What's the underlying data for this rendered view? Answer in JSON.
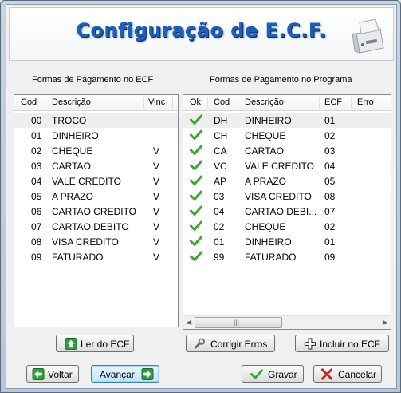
{
  "title": "Configuração de E.C.F.",
  "ecf": {
    "label": "Formas de Pagamento no ECF",
    "columns": [
      "Cod",
      "Descrição",
      "Vinc"
    ],
    "rows": [
      {
        "cod": "00",
        "desc": "TROCO",
        "vinc": ""
      },
      {
        "cod": "01",
        "desc": "DINHEIRO",
        "vinc": ""
      },
      {
        "cod": "02",
        "desc": "CHEQUE",
        "vinc": "V"
      },
      {
        "cod": "03",
        "desc": "CARTAO",
        "vinc": "V"
      },
      {
        "cod": "04",
        "desc": "VALE CREDITO",
        "vinc": "V"
      },
      {
        "cod": "05",
        "desc": "A PRAZO",
        "vinc": "V"
      },
      {
        "cod": "06",
        "desc": "CARTAO CREDITO",
        "vinc": "V"
      },
      {
        "cod": "07",
        "desc": "CARTAO DEBITO",
        "vinc": "V"
      },
      {
        "cod": "08",
        "desc": "VISA CREDITO",
        "vinc": "V"
      },
      {
        "cod": "09",
        "desc": "FATURADO",
        "vinc": "V"
      }
    ]
  },
  "programa": {
    "label": "Formas de Pagamento no Programa",
    "columns": [
      "Ok",
      "Cod",
      "Descrição",
      "ECF",
      "Erro"
    ],
    "rows": [
      {
        "cod": "DH",
        "desc": "DINHEIRO",
        "ecf": "01"
      },
      {
        "cod": "CH",
        "desc": "CHEQUE",
        "ecf": "02"
      },
      {
        "cod": "CA",
        "desc": "CARTAO",
        "ecf": "03"
      },
      {
        "cod": "VC",
        "desc": "VALE CREDITO",
        "ecf": "04"
      },
      {
        "cod": "AP",
        "desc": "A PRAZO",
        "ecf": "05"
      },
      {
        "cod": "03",
        "desc": "VISA CREDITO",
        "ecf": "08"
      },
      {
        "cod": "04",
        "desc": "CARTAO DEBI...",
        "ecf": "07"
      },
      {
        "cod": "02",
        "desc": "CHEQUE",
        "ecf": "02"
      },
      {
        "cod": "01",
        "desc": "DINHEIRO",
        "ecf": "01"
      },
      {
        "cod": "99",
        "desc": "FATURADO",
        "ecf": "09"
      }
    ]
  },
  "buttons": {
    "ler": "Ler do ECF",
    "corrigir": "Corrigir Erros",
    "incluir": "Incluir no ECF",
    "voltar": "Voltar",
    "avancar": "Avançar",
    "gravar": "Gravar",
    "cancelar": "Cancelar"
  },
  "icons": {
    "check": "check-icon",
    "up_arrow": "arrow-up-icon",
    "wrench": "wrench-icon",
    "plus": "plus-icon",
    "left_arrow": "arrow-left-icon",
    "right_arrow": "arrow-right-icon",
    "cancel": "x-icon",
    "printer": "printer-icon"
  },
  "colors": {
    "title": "#1f5fb8",
    "check": "#3aa832",
    "arrow_green": "#2e9e3a",
    "cancel_red": "#d02020"
  }
}
